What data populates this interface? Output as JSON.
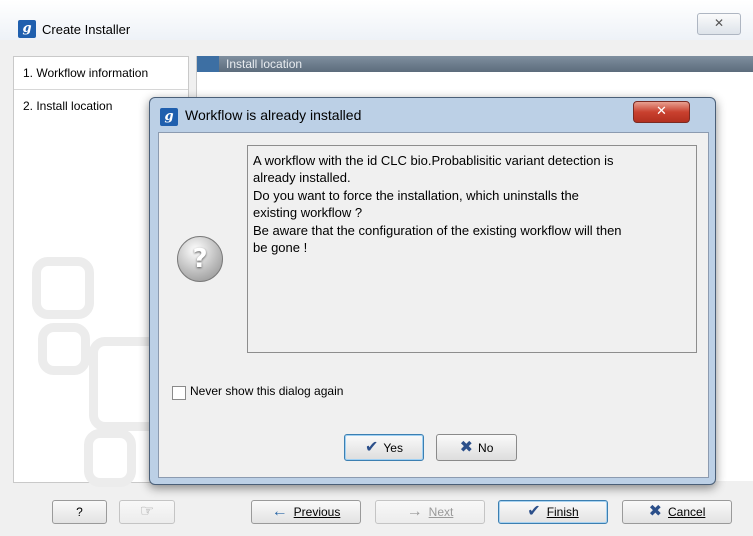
{
  "window": {
    "title": "Create Installer",
    "app_icon": "g",
    "close_glyph": "✕"
  },
  "steps": [
    {
      "label": "1.  Workflow information"
    },
    {
      "label": "2.  Install location"
    }
  ],
  "panel": {
    "header": "Install location"
  },
  "dialog": {
    "title": "Workflow is already installed",
    "close_glyph": "✕",
    "message_lines": [
      "A workflow with the id CLC bio.Probablisitic variant detection is",
      "already installed.",
      "Do you want to force the installation, which uninstalls the",
      "existing workflow ?",
      "Be aware that the configuration of the existing workflow will then",
      "be gone !"
    ],
    "icon_glyph": "?",
    "checkbox_label": "Never show this dialog again",
    "yes_label": "Yes",
    "no_label": "No",
    "yes_icon": "✔",
    "no_icon": "✖"
  },
  "buttons": {
    "help": "?",
    "help_icon": "☞",
    "previous": "Previous",
    "next": "Next",
    "finish": "Finish",
    "cancel": "Cancel",
    "previous_icon": "←",
    "next_icon": "→",
    "finish_icon": "✔",
    "cancel_icon": "✖"
  },
  "colors": {
    "dialog_frame": "#bcd0e6",
    "close_red": "#c9412f",
    "header_bar": "#6b7b8b",
    "primary_border": "#3c7fb1"
  }
}
